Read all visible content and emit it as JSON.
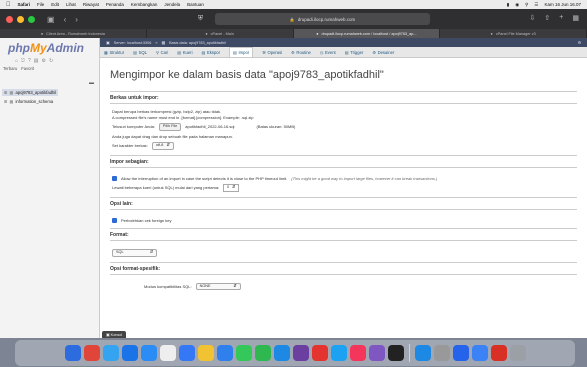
{
  "menubar": {
    "app": "Safari",
    "items": [
      "File",
      "Edit",
      "Lihat",
      "Riwayat",
      "Penanda",
      "Kembangkan",
      "Jendela",
      "Bantuan"
    ],
    "clock": "Kam 16 Jun 16.07"
  },
  "browser": {
    "url": "drupadi.ilocp.rumahweb.com",
    "tabs": [
      "Client Area - Rumahweb Indonesia",
      "cPanel - Main",
      "drupadi.ilocp.rumahweb.com / localhost / apoj9783_ap...",
      "cPanel File Manager v3"
    ]
  },
  "pma": {
    "logo": {
      "php": "php",
      "my": "My",
      "admin": "Admin"
    },
    "left_tabs": [
      "Terbaru",
      "Favorit"
    ],
    "databases": [
      "apoj9783_apotikfadhil",
      "information_schema"
    ],
    "breadcrumb": [
      "Server: localhost:3306",
      "Basis data: apoj9783_apotikfadhil"
    ],
    "topmenu": [
      "Struktur",
      "SQL",
      "Cari",
      "Kueri",
      "Ekspor",
      "Impor",
      "Operasi",
      "Routine",
      "Event",
      "Trigger",
      "Desainer"
    ],
    "active_tab": "Impor",
    "page_title": "Mengimpor ke dalam basis data \"apoj9783_apotikfadhil\"",
    "file_section": {
      "title": "Berkas untuk impor:",
      "line1": "Dapat berupa berkas terkompresi (gzip, bzip2, zip) atau tidak.",
      "line2": "A compressed file's name must end in .[format].[compression]. Example: .sql.zip",
      "browse_label": "Telusuri komputer Anda:",
      "browse_button": "Pilih File",
      "file_name": "apotikfadhil_2022-06-16.sql",
      "max_size": "(Batas ukuran: 50MB)",
      "drag_hint": "Anda juga dapat drag dan drop sebuah file pada halaman manapun.",
      "charset_label": "Set karakter berkas:",
      "charset_value": "utf-8"
    },
    "partial_section": {
      "title": "Impor sebagian:",
      "interrupt_text": "Allow the interruption of an import in case the script detects it is close to the PHP timeout limit.",
      "interrupt_note": "(This might be a good way to import large files, however it can break transactions.)",
      "skip_label": "Lewati beberapa kueri (untuk SQL) mulai dari yang pertama:",
      "skip_value": "0"
    },
    "other_section": {
      "title": "Opsi lain:",
      "fk_label": "Perbolehkan cek foreign key"
    },
    "format_section": {
      "title": "Format:",
      "value": "SQL"
    },
    "specific_section": {
      "title": "Opsi format-spesifik:",
      "compat_label": "Modus kompatibilitas SQL:",
      "compat_value": "NONE"
    },
    "console_label": "Konsol"
  },
  "dock": {
    "colors": [
      "#2d6cdf",
      "#e0453a",
      "#34a4f0",
      "#1b73e8",
      "#2b8cf5",
      "#eeeeee",
      "#3478f6",
      "#f1c232",
      "#2f80ed",
      "#34c759",
      "#2fb84f",
      "#1e88e5",
      "#6b3fa0",
      "#e3342f",
      "#1da1f2",
      "#f5365c",
      "#7e57c2",
      "#222222",
      "#1e88e5",
      "#999999",
      "#2563eb",
      "#3b82f6",
      "#d93025",
      "#9aa0a6"
    ]
  }
}
